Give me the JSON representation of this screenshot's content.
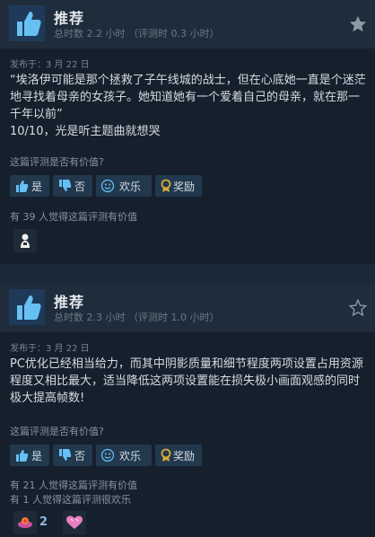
{
  "reviews": [
    {
      "verdict": "推荐",
      "hours": "总时数 2.2 小时 （评测时 0.3 小时）",
      "posted": "发布于：3 月 22 日",
      "body_lines": [
        "“埃洛伊可能是那个拯救了子午线城的战士，但在心底她一直是个迷茫地寻找着母亲的女孩子。她知道她有一个爱着自己的母亲，就在那一千年以前”",
        "10/10，光是听主题曲就想哭"
      ],
      "helpful_question": "这篇评测是否有价值?",
      "buttons": {
        "yes": "是",
        "no": "否",
        "funny": "欢乐",
        "award": "奖励"
      },
      "helpful_count": "有 39 人觉得这篇评测有价值",
      "funny_count": "",
      "awards": [
        {
          "icon": "person-award-icon",
          "count": ""
        }
      ]
    },
    {
      "verdict": "推荐",
      "hours": "总时数 2.3 小时 （评测时 1.0 小时）",
      "posted": "发布于：3 月 22 日",
      "body_lines": [
        "PC优化已经相当给力，而其中阴影质量和细节程度两项设置占用资源程度又相比最大，适当降低这两项设置能在损失极小画面观感的同时极大提高帧数!"
      ],
      "helpful_question": "这篇评测是否有价值?",
      "buttons": {
        "yes": "是",
        "no": "否",
        "funny": "欢乐",
        "award": "奖励"
      },
      "helpful_count": "有 21 人觉得这篇评测有价值",
      "funny_count": "有 1 人觉得这篇评测很欢乐",
      "awards": [
        {
          "icon": "clown-award-icon",
          "count": "2"
        },
        {
          "icon": "heart-award-icon",
          "count": ""
        }
      ]
    }
  ],
  "colors": {
    "thumb": "#66c0f4",
    "award_gold": "#d8a93a"
  }
}
